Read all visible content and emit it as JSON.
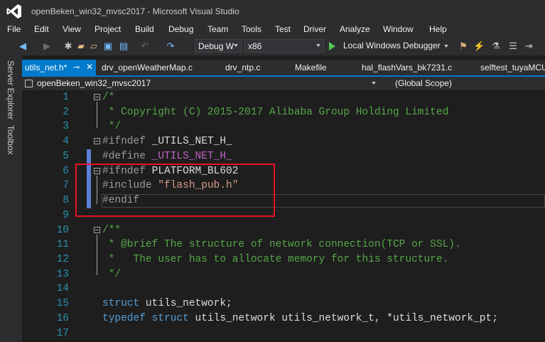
{
  "window": {
    "title": "openBeken_win32_mvsc2017 - Microsoft Visual Studio"
  },
  "menu": [
    "File",
    "Edit",
    "View",
    "Project",
    "Build",
    "Debug",
    "Team",
    "Tools",
    "Test",
    "Driver",
    "Analyze",
    "Window",
    "Help"
  ],
  "toolbar": {
    "config": "Debug W",
    "platform": "x86",
    "run_label": "Local Windows Debugger"
  },
  "side_panels": [
    "Server Explorer",
    "Toolbox"
  ],
  "tabs": [
    {
      "label": "utils_net.h*",
      "active": true
    },
    {
      "label": "drv_openWeatherMap.c",
      "active": false
    },
    {
      "label": "drv_ntp.c",
      "active": false
    },
    {
      "label": "Makefile",
      "active": false
    },
    {
      "label": "hal_flashVars_bk7231.c",
      "active": false
    },
    {
      "label": "selftest_tuyaMCU",
      "active": false
    }
  ],
  "nav": {
    "project": "openBeken_win32_mvsc2017",
    "scope": "(Global Scope)"
  },
  "code_lines": [
    {
      "n": "1",
      "text": "/*"
    },
    {
      "n": "2",
      "text": " * Copyright (C) 2015-2017 Alibaba Group Holding Limited"
    },
    {
      "n": "3",
      "text": " */"
    },
    {
      "n": "4",
      "text": "#ifndef _UTILS_NET_H_"
    },
    {
      "n": "5",
      "text": "#define _UTILS_NET_H_"
    },
    {
      "n": "6",
      "text": "#ifndef PLATFORM_BL602"
    },
    {
      "n": "7",
      "text": "#include \"flash_pub.h\""
    },
    {
      "n": "8",
      "text": "#endif"
    },
    {
      "n": "9",
      "text": ""
    },
    {
      "n": "10",
      "text": "/**"
    },
    {
      "n": "11",
      "text": " * @brief The structure of network connection(TCP or SSL)."
    },
    {
      "n": "12",
      "text": " *   The user has to allocate memory for this structure."
    },
    {
      "n": "13",
      "text": " */"
    },
    {
      "n": "14",
      "text": ""
    },
    {
      "n": "15",
      "text": "struct utils_network;"
    },
    {
      "n": "16",
      "text": "typedef struct utils_network utils_network_t, *utils_network_pt;"
    },
    {
      "n": "17",
      "text": ""
    }
  ],
  "colors": {
    "accent": "#007acc",
    "comment": "#57a64a",
    "keyword": "#569cd6",
    "string": "#d69d85",
    "macro": "#bd63c5",
    "highlight_box": "#e81123"
  }
}
